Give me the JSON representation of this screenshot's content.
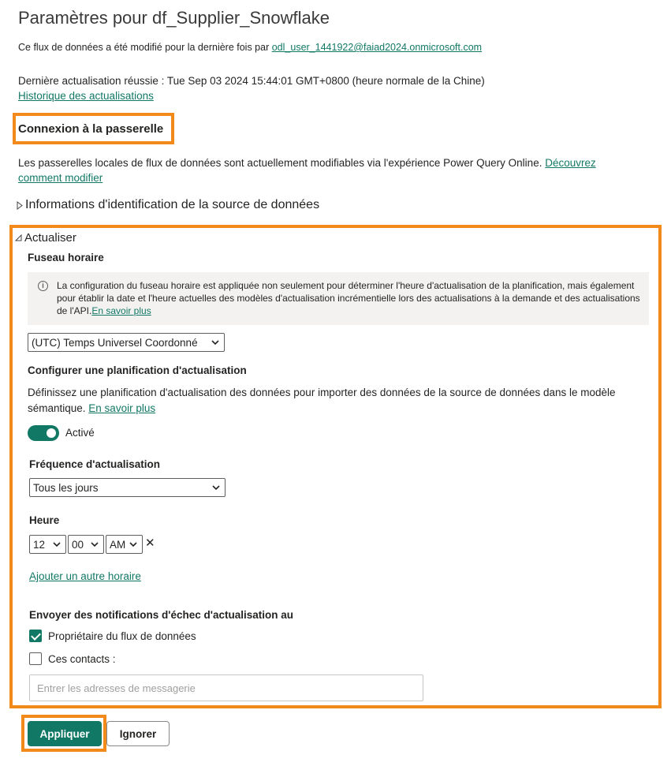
{
  "header": {
    "title": "Paramètres pour df_Supplier_Snowflake",
    "modified_prefix": "Ce flux de données a été modifié pour la dernière fois par ",
    "modified_user": "odl_user_1441922@faiad2024.onmicrosoft.com",
    "last_refresh": "Dernière actualisation réussie : Tue Sep 03 2024 15:44:01 GMT+0800 (heure normale de la Chine)",
    "history_link": "Historique des actualisations"
  },
  "gateway": {
    "heading": "Connexion à la passerelle",
    "text": "Les passerelles locales de flux de données sont actuellement modifiables via l'expérience Power Query Online. ",
    "learn_link": "Découvrez comment modifier"
  },
  "credentials": {
    "label": "Informations d'identification de la source de données"
  },
  "refresh": {
    "label": "Actualiser",
    "timezone": {
      "label": "Fuseau horaire",
      "info_text": "La configuration du fuseau horaire est appliquée non seulement pour déterminer l'heure d'actualisation de la planification, mais également pour établir la date et l'heure actuelles des modèles d'actualisation incrémentielle lors des actualisations à la demande et des actualisations de l'API.",
      "info_link": "En savoir plus",
      "selected": "(UTC) Temps Universel Coordonné"
    },
    "schedule": {
      "label": "Configurer une planification d'actualisation",
      "description": "Définissez une planification d'actualisation des données pour importer des données de la source de données dans le modèle sémantique. ",
      "learn_link": "En savoir plus",
      "toggle_label": "Activé",
      "enabled": true
    },
    "frequency": {
      "label": "Fréquence d'actualisation",
      "selected": "Tous les jours"
    },
    "time": {
      "label": "Heure",
      "hour": "12",
      "minute": "00",
      "ampm": "AM",
      "remove_symbol": "✕"
    },
    "add_schedule_link": "Ajouter un autre horaire",
    "notifications": {
      "label": "Envoyer des notifications d'échec d'actualisation au",
      "owner_label": "Propriétaire du flux de données",
      "owner_checked": true,
      "contacts_label": "Ces contacts :",
      "contacts_checked": false,
      "email_placeholder": "Entrer les adresses de messagerie",
      "email_value": ""
    }
  },
  "actions": {
    "apply_label": "Appliquer",
    "ignore_label": "Ignorer"
  },
  "colors": {
    "accent": "#117865",
    "highlight": "#f28a1b"
  },
  "icons": {
    "info": "info-icon",
    "chevron": "chevron-down-icon",
    "expand": "caret-right-icon",
    "collapse": "caret-down-icon"
  }
}
